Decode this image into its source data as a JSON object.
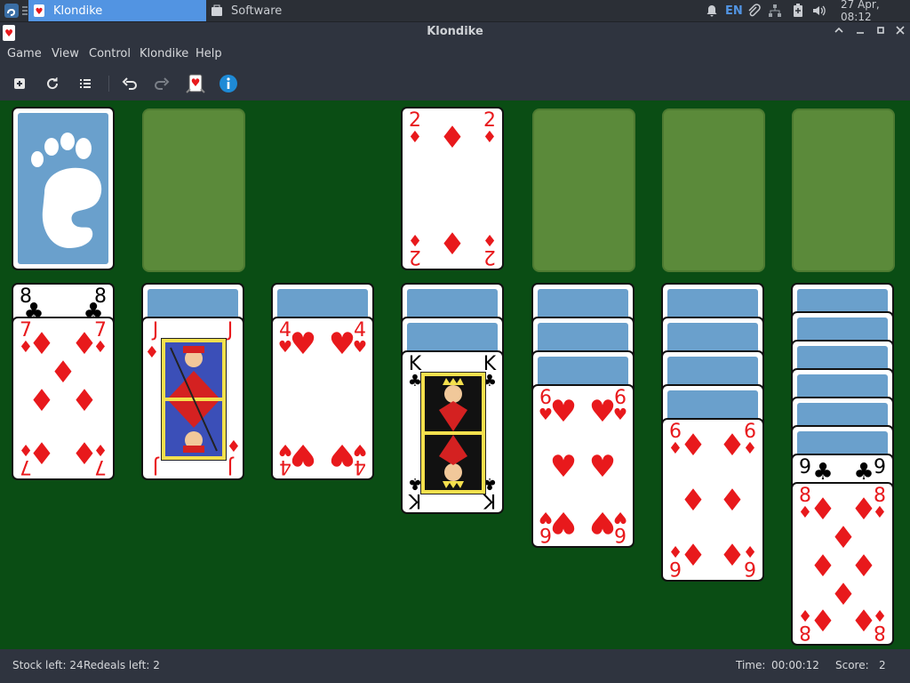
{
  "taskbar": {
    "tasks": [
      {
        "label": "Klondike",
        "active": true
      },
      {
        "label": "Software",
        "active": false
      }
    ],
    "language": "EN",
    "clock": "27 Apr, 08:12"
  },
  "window": {
    "title": "Klondike"
  },
  "menu": [
    "Game",
    "View",
    "Control",
    "Klondike",
    "Help"
  ],
  "toolbar": {
    "icons": [
      "new-game-icon",
      "restart-icon",
      "select-game-icon",
      "undo-icon",
      "redo-icon",
      "hint-icon",
      "info-icon"
    ]
  },
  "board": {
    "stock": {
      "face_down": true
    },
    "foundations": [
      {
        "rank": "2",
        "suit": "♦",
        "color": "red"
      },
      {
        "empty": true
      },
      {
        "empty": true
      },
      {
        "empty": true
      }
    ],
    "tableau": [
      {
        "cards": [
          {
            "rank": "8",
            "suit": "♣"
          },
          {
            "rank": "7",
            "suit": "♦"
          }
        ]
      },
      {
        "hidden": 1,
        "cards": [
          {
            "rank": "J",
            "suit": "♦"
          }
        ]
      },
      {
        "hidden": 1,
        "cards": [
          {
            "rank": "4",
            "suit": "♥"
          }
        ]
      },
      {
        "hidden": 2,
        "cards": [
          {
            "rank": "K",
            "suit": "♣"
          }
        ]
      },
      {
        "hidden": 3,
        "cards": [
          {
            "rank": "6",
            "suit": "♥"
          }
        ]
      },
      {
        "hidden": 4,
        "cards": [
          {
            "rank": "6",
            "suit": "♦"
          }
        ]
      },
      {
        "hidden": 6,
        "cards": [
          {
            "rank": "9",
            "suit": "♣"
          },
          {
            "rank": "8",
            "suit": "♦"
          }
        ]
      }
    ]
  },
  "status": {
    "stock_left": "Stock left: 24",
    "redeals_left": "Redeals left: 2",
    "time_label": "Time:",
    "time_value": "00:00:12",
    "score_label": "Score:",
    "score_value": "2"
  },
  "colors": {
    "felt": "#0a4d14",
    "empty_slot": "#5b8a3a",
    "card_back": "#6aa0cc",
    "red_suit": "#e8191c",
    "accent": "#5294e2"
  }
}
